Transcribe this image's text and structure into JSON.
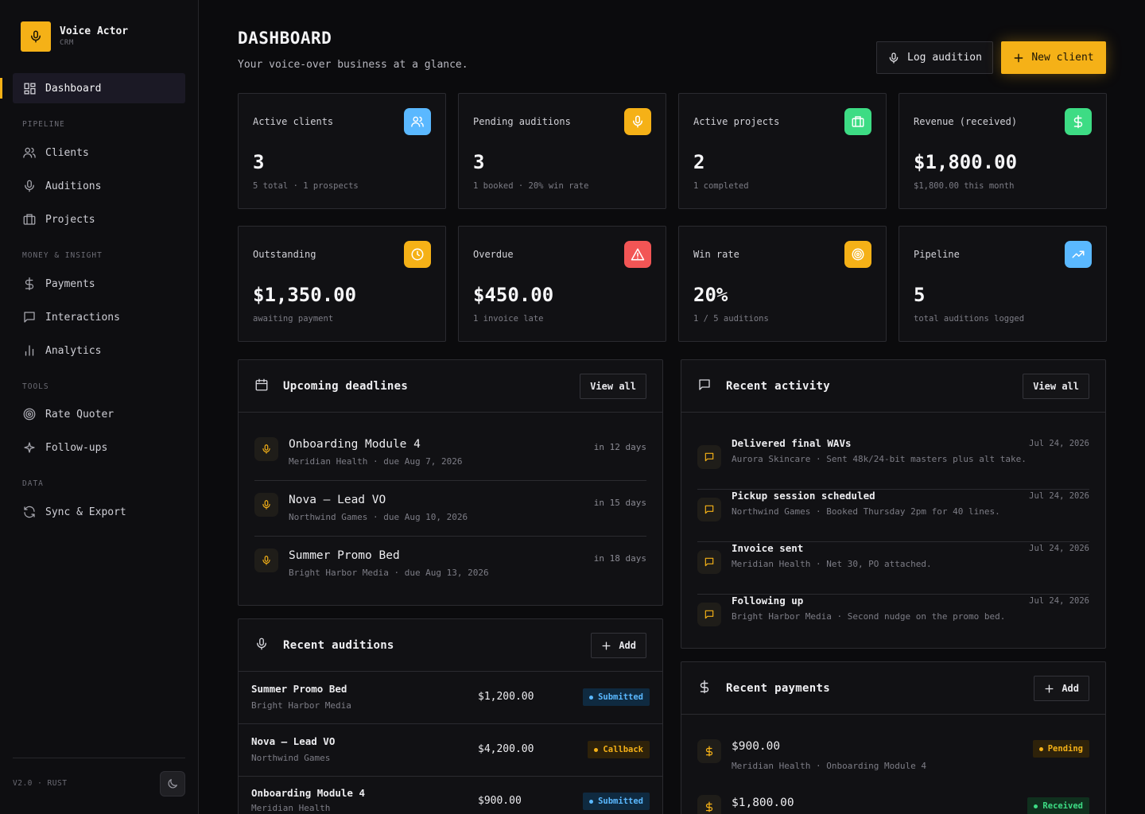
{
  "brand": {
    "title": "Voice Actor",
    "subtitle": "CRM",
    "logo_icon": "mic-icon",
    "accent": "#f5b117"
  },
  "sidebar": {
    "active": {
      "label": "Dashboard",
      "icon": "dashboard-icon"
    },
    "sections": [
      {
        "title": "PIPELINE",
        "items": [
          {
            "label": "Clients",
            "icon": "users-icon"
          },
          {
            "label": "Auditions",
            "icon": "mic-icon"
          },
          {
            "label": "Projects",
            "icon": "briefcase-icon"
          }
        ]
      },
      {
        "title": "MONEY & INSIGHT",
        "items": [
          {
            "label": "Payments",
            "icon": "dollar-icon"
          },
          {
            "label": "Interactions",
            "icon": "message-icon"
          },
          {
            "label": "Analytics",
            "icon": "bar-chart-icon"
          }
        ]
      },
      {
        "title": "TOOLS",
        "items": [
          {
            "label": "Rate Quoter",
            "icon": "target-icon"
          },
          {
            "label": "Follow-ups",
            "icon": "sparkle-icon"
          }
        ]
      },
      {
        "title": "DATA",
        "items": [
          {
            "label": "Sync & Export",
            "icon": "sync-icon"
          }
        ]
      }
    ],
    "version": "V2.0 · RUST",
    "theme_toggle_icon": "moon-icon"
  },
  "header": {
    "title": "DASHBOARD",
    "subtitle": "Your voice-over business at a glance.",
    "log_audition": "Log audition",
    "new_client": "New client"
  },
  "stats": [
    {
      "label": "Active clients",
      "value": "3",
      "sub": "5 total · 1 prospects",
      "icon": "users-icon",
      "color": "#5ab8ff"
    },
    {
      "label": "Pending auditions",
      "value": "3",
      "sub": "1 booked · 20% win rate",
      "icon": "mic-icon",
      "color": "#f5b117"
    },
    {
      "label": "Active projects",
      "value": "2",
      "sub": "1 completed",
      "icon": "briefcase-icon",
      "color": "#3ddc84"
    },
    {
      "label": "Revenue (received)",
      "value": "$1,800.00",
      "sub": "$1,800.00 this month",
      "icon": "dollar-icon",
      "color": "#3ddc84"
    },
    {
      "label": "Outstanding",
      "value": "$1,350.00",
      "sub": "awaiting payment",
      "icon": "clock-icon",
      "color": "#f5b117"
    },
    {
      "label": "Overdue",
      "value": "$450.00",
      "sub": "1 invoice late",
      "icon": "alert-icon",
      "color": "#f25555"
    },
    {
      "label": "Win rate",
      "value": "20%",
      "sub": "1 / 5 auditions",
      "icon": "target-icon",
      "color": "#f5b117"
    },
    {
      "label": "Pipeline",
      "value": "5",
      "sub": "total auditions logged",
      "icon": "trend-up-icon",
      "color": "#5ab8ff"
    }
  ],
  "deadlines": {
    "title": "Upcoming deadlines",
    "view_all": "View all",
    "items": [
      {
        "title": "Onboarding Module 4",
        "sub": "Meridian Health · due Aug 7, 2026",
        "when": "in 12 days"
      },
      {
        "title": "Nova — Lead VO",
        "sub": "Northwind Games · due Aug 10, 2026",
        "when": "in 15 days"
      },
      {
        "title": "Summer Promo Bed",
        "sub": "Bright Harbor Media · due Aug 13, 2026",
        "when": "in 18 days"
      }
    ]
  },
  "activity": {
    "title": "Recent activity",
    "view_all": "View all",
    "items": [
      {
        "title": "Delivered final WAVs",
        "sub": "Aurora Skincare · Sent 48k/24-bit masters plus alt take.",
        "date": "Jul 24, 2026"
      },
      {
        "title": "Pickup session scheduled",
        "sub": "Northwind Games · Booked Thursday 2pm for 40 lines.",
        "date": "Jul 24, 2026"
      },
      {
        "title": "Invoice sent",
        "sub": "Meridian Health · Net 30, PO attached.",
        "date": "Jul 24, 2026"
      },
      {
        "title": "Following up",
        "sub": "Bright Harbor Media · Second nudge on the promo bed.",
        "date": "Jul 24, 2026"
      }
    ]
  },
  "auditions": {
    "title": "Recent auditions",
    "add": "Add",
    "rows": [
      {
        "title": "Summer Promo Bed",
        "client": "Bright Harbor Media",
        "amount": "$1,200.00",
        "status": "Submitted",
        "status_color": "blue"
      },
      {
        "title": "Nova — Lead VO",
        "client": "Northwind Games",
        "amount": "$4,200.00",
        "status": "Callback",
        "status_color": "amber"
      },
      {
        "title": "Onboarding Module 4",
        "client": "Meridian Health",
        "amount": "$900.00",
        "status": "Submitted",
        "status_color": "blue"
      }
    ]
  },
  "payments": {
    "title": "Recent payments",
    "add": "Add",
    "rows": [
      {
        "amount": "$900.00",
        "sub": "Meridian Health · Onboarding Module 4",
        "status": "Pending",
        "status_color": "amber"
      },
      {
        "amount": "$1,800.00",
        "sub": "",
        "status": "Received",
        "status_color": "green"
      }
    ]
  }
}
